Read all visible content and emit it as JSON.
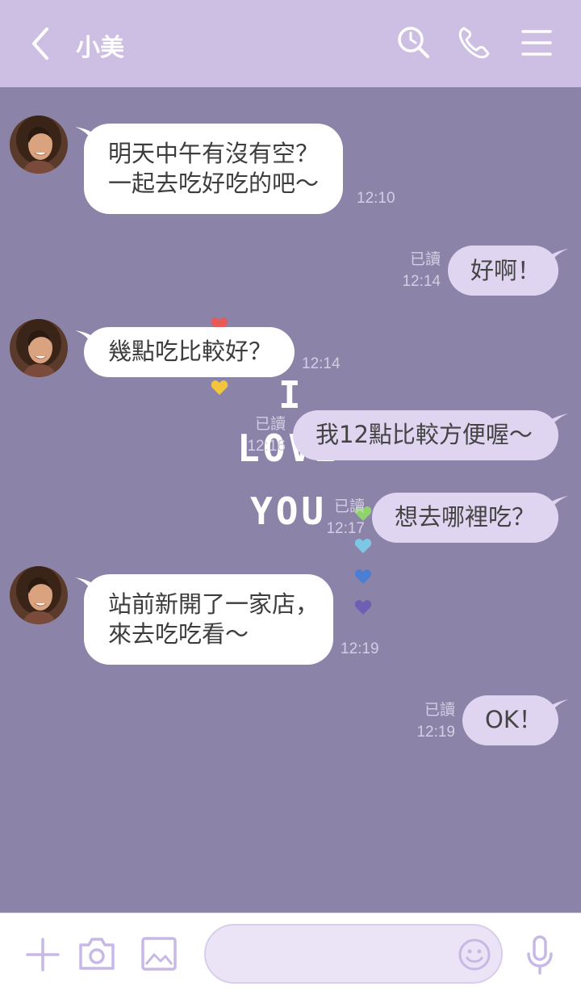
{
  "header": {
    "title": "小美",
    "icons": [
      "back-icon",
      "search-clock-icon",
      "phone-icon",
      "menu-icon"
    ]
  },
  "messages": [
    {
      "side": "in",
      "lines": [
        "明天中午有沒有空？",
        "一起去吃好吃的吧～"
      ],
      "time": "12:10"
    },
    {
      "side": "out",
      "text": "好啊！",
      "read": "已讀",
      "time": "12:14"
    },
    {
      "side": "in",
      "text": "幾點吃比較好？",
      "time": "12:14"
    },
    {
      "side": "out",
      "text": "我12點比較方便喔～",
      "read": "已讀",
      "time": "12:16"
    },
    {
      "side": "out",
      "text": "想去哪裡吃？",
      "read": "已讀",
      "time": "12:17"
    },
    {
      "side": "in",
      "lines": [
        "站前新開了一家店，",
        "來去吃吃看～"
      ],
      "time": "12:19"
    },
    {
      "side": "out",
      "text": "OK！",
      "read": "已讀",
      "time": "12:19"
    }
  ],
  "decoration": {
    "line1": "I",
    "line2": "LOVE",
    "line3": "YOU",
    "heart_colors": [
      "#e85a5a",
      "#f2c53d",
      "#8ed36c",
      "#7ec6e6",
      "#4a7fd4",
      "#6f5fb2"
    ]
  },
  "footer": {
    "icons": [
      "plus-icon",
      "camera-icon",
      "image-icon",
      "emoji-icon",
      "microphone-icon"
    ],
    "input_value": ""
  },
  "colors": {
    "header_bg": "#ccbfe3",
    "chat_bg": "#8c84a8",
    "incoming_bubble": "#ffffff",
    "outgoing_bubble": "#e0d5f0",
    "accent": "#c8b8e6"
  }
}
